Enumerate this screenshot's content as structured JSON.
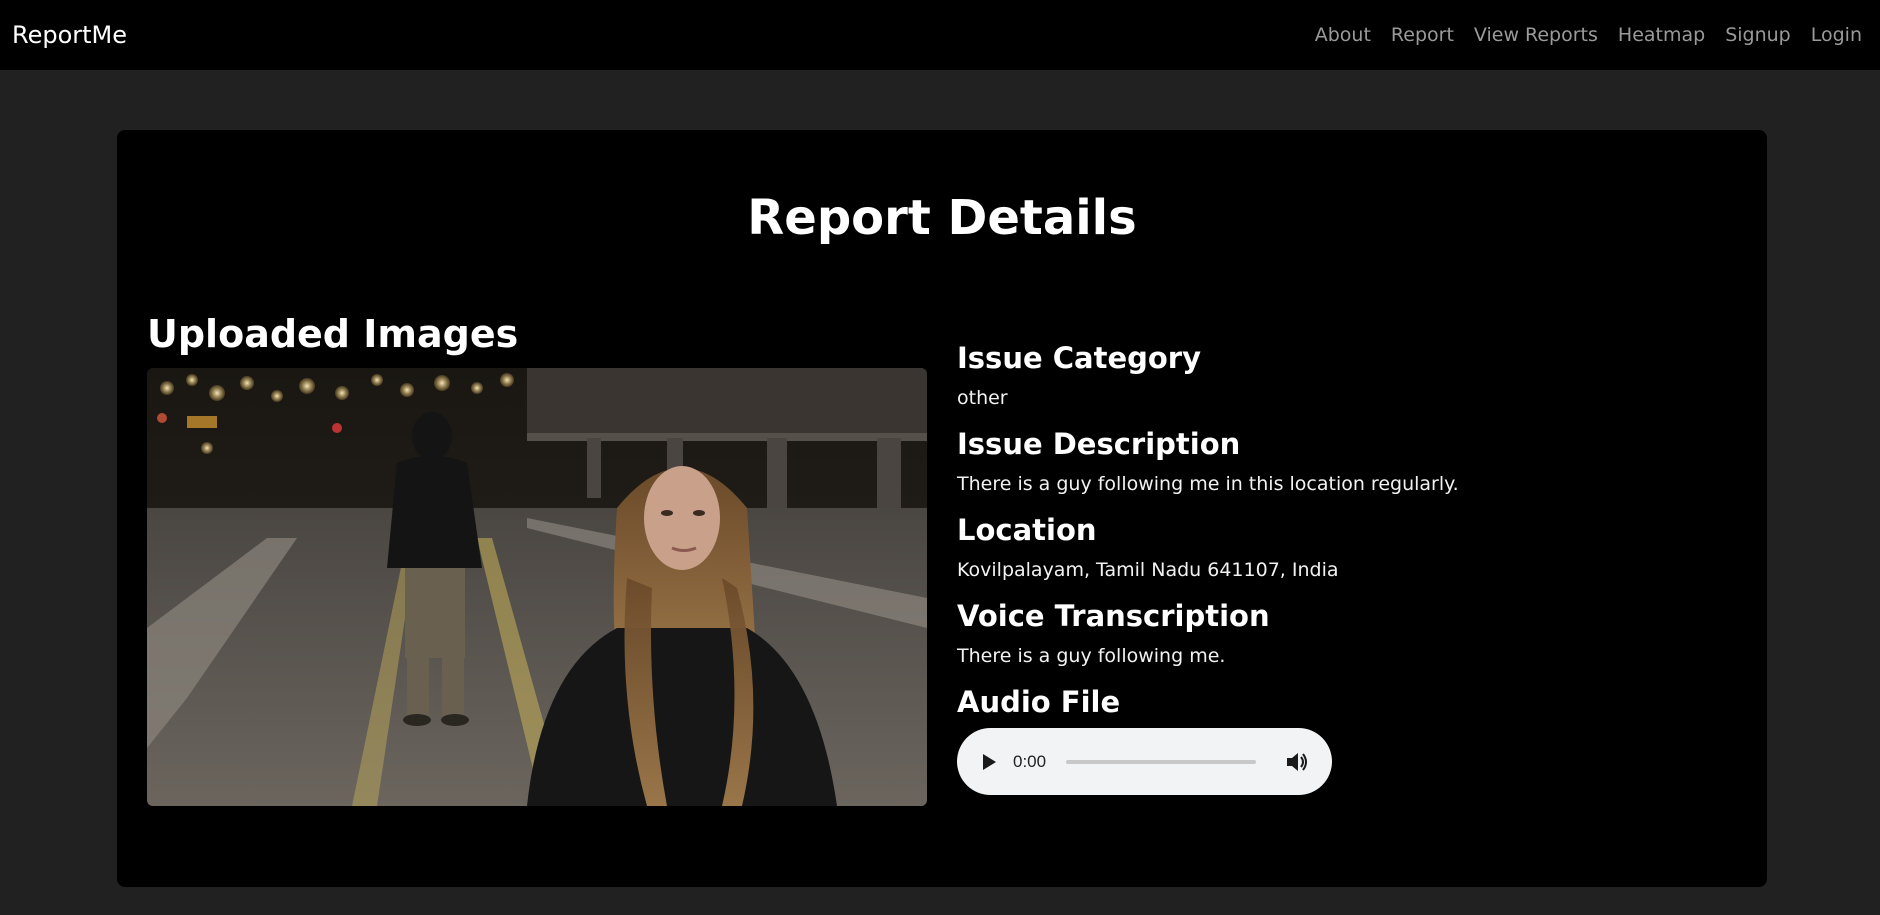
{
  "navbar": {
    "brand": "ReportMe",
    "links": [
      "About",
      "Report",
      "View Reports",
      "Heatmap",
      "Signup",
      "Login"
    ]
  },
  "page": {
    "title": "Report Details"
  },
  "images": {
    "heading": "Uploaded Images",
    "photo_icon": "night-street-photo"
  },
  "details": {
    "fields": [
      {
        "heading": "Issue Category",
        "value": "other"
      },
      {
        "heading": "Issue Description",
        "value": "There is a guy following me in this location regularly."
      },
      {
        "heading": "Location",
        "value": "Kovilpalayam, Tamil Nadu 641107, India"
      },
      {
        "heading": "Voice Transcription",
        "value": "There is a guy following me."
      }
    ],
    "audio_heading": "Audio File"
  },
  "audio": {
    "time": "0:00",
    "progress": 0,
    "play_icon": "play-icon",
    "volume_icon": "volume-icon"
  },
  "colors": {
    "page_bg": "#212121",
    "navbar_bg": "#000000",
    "card_bg": "#000000",
    "nav_link": "#9a9a9a",
    "player_bg": "#f1f3f4"
  }
}
